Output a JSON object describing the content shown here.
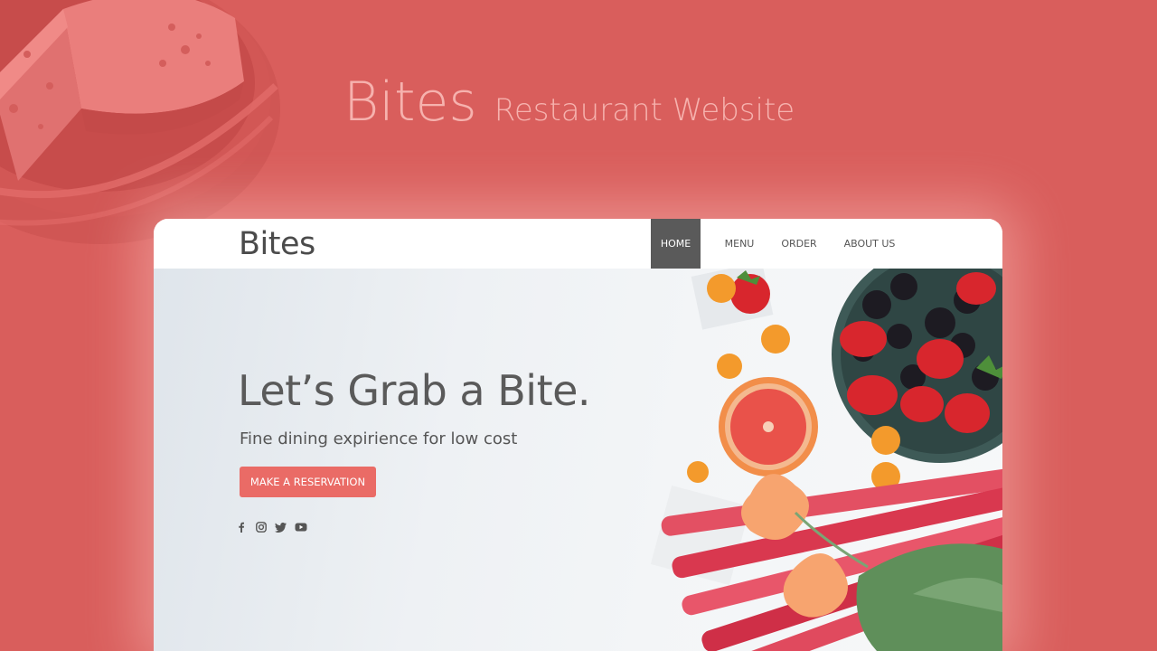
{
  "showcase": {
    "title": "Bites",
    "subtitle": "Restaurant Website"
  },
  "site": {
    "logo": "Bites",
    "nav": [
      {
        "label": "HOME",
        "active": true
      },
      {
        "label": "MENU",
        "active": false
      },
      {
        "label": "ORDER",
        "active": false
      },
      {
        "label": "ABOUT US",
        "active": false
      }
    ],
    "hero": {
      "headline": "Let’s Grab a Bite.",
      "subheadline": "Fine dining expirience for low cost",
      "cta_label": "MAKE A RESERVATION"
    },
    "socials": [
      "facebook-icon",
      "instagram-icon",
      "twitter-icon",
      "youtube-icon"
    ]
  },
  "colors": {
    "background": "#d95e5c",
    "accent": "#ea6b66",
    "nav_active": "#5a5a5a",
    "text_dark": "#4b4b4b"
  }
}
